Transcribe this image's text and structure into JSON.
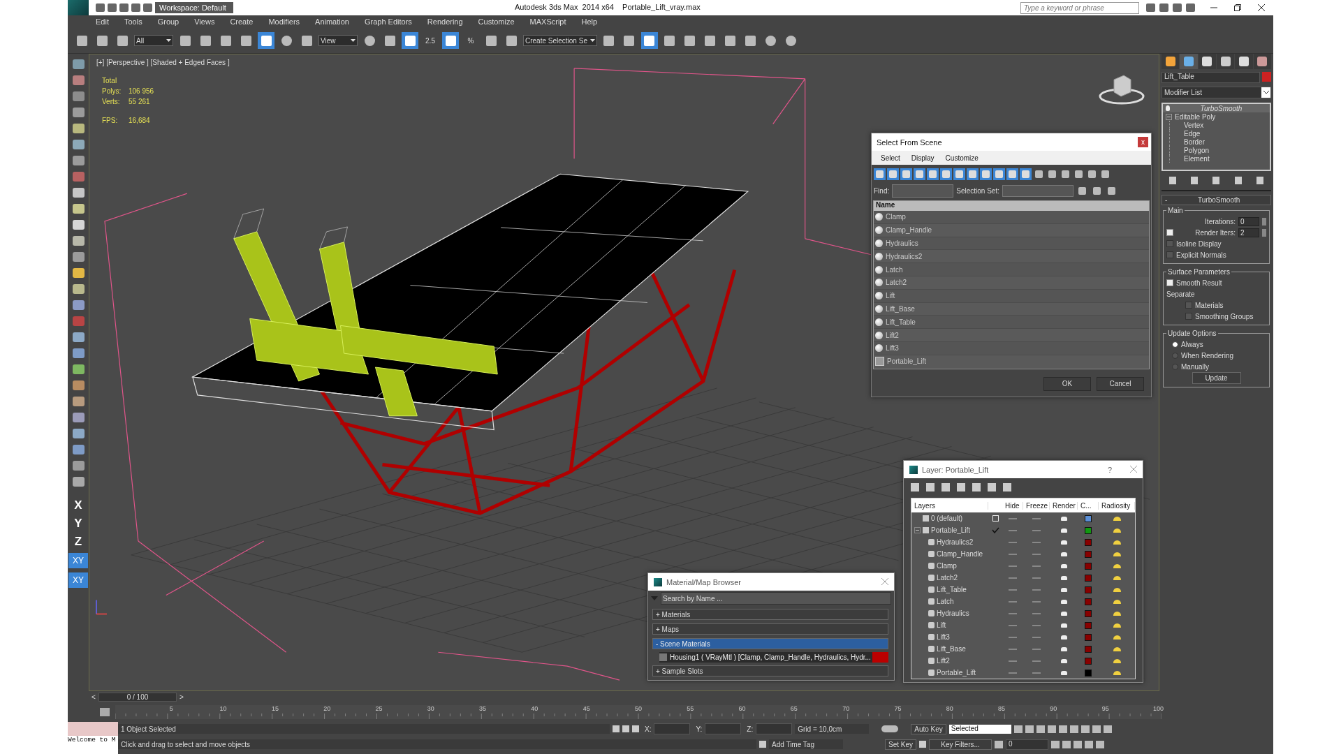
{
  "app_title": {
    "workspace": "Workspace: Default",
    "title": "Autodesk 3ds Max  2014 x64    Portable_Lift_vray.max",
    "search_placeholder": "Type a keyword or phrase"
  },
  "menu": [
    "Edit",
    "Tools",
    "Group",
    "Views",
    "Create",
    "Modifiers",
    "Animation",
    "Graph Editors",
    "Rendering",
    "Customize",
    "MAXScript",
    "Help"
  ],
  "main_toolbar": [
    {
      "kind": "link",
      "selected": false
    },
    {
      "kind": "unlink",
      "selected": false
    },
    {
      "kind": "bind",
      "selected": false
    },
    {
      "kind": "dropdown",
      "value": "All"
    },
    {
      "kind": "select",
      "selected": false
    },
    {
      "kind": "list",
      "selected": false
    },
    {
      "kind": "rect",
      "selected": false
    },
    {
      "kind": "window",
      "selected": false
    },
    {
      "kind": "move",
      "selected": true
    },
    {
      "kind": "rotate",
      "selected": false
    },
    {
      "kind": "scale",
      "selected": false
    },
    {
      "kind": "dropdown",
      "value": "View"
    },
    {
      "kind": "pivot",
      "selected": false
    },
    {
      "kind": "move",
      "selected": false
    },
    {
      "kind": "keyboard",
      "selected": true
    },
    {
      "kind": "snap",
      "label": "2.5",
      "selected": false
    },
    {
      "kind": "angle",
      "selected": true
    },
    {
      "kind": "snap",
      "label": "%",
      "selected": false
    },
    {
      "kind": "spinner",
      "selected": false
    },
    {
      "kind": "edit",
      "selected": false
    },
    {
      "kind": "dropdown",
      "value": "Create Selection Se"
    },
    {
      "kind": "mirror",
      "selected": false
    },
    {
      "kind": "align",
      "selected": false
    },
    {
      "kind": "layers",
      "selected": true
    },
    {
      "kind": "render",
      "selected": false
    },
    {
      "kind": "curve",
      "selected": false
    },
    {
      "kind": "schematic",
      "selected": false
    },
    {
      "kind": "material",
      "selected": false
    },
    {
      "kind": "render",
      "selected": false
    },
    {
      "kind": "teapot",
      "selected": false
    },
    {
      "kind": "teapot",
      "selected": false
    }
  ],
  "viewport": {
    "label": "[+] [Perspective ] [Shaded + Edged Faces ]",
    "stats": [
      {
        "name": "Total"
      },
      {
        "name": "Polys:",
        "value": "106 956"
      },
      {
        "name": "Verts:",
        "value": "55 261"
      }
    ],
    "fps": {
      "name": "FPS:",
      "value": "16,684"
    }
  },
  "axis_buttons": [
    {
      "label": "X",
      "kind": "plain"
    },
    {
      "label": "Y",
      "kind": "plain"
    },
    {
      "label": "Z",
      "kind": "plain"
    },
    {
      "label": "XY",
      "kind": "button"
    },
    {
      "label": "XY",
      "kind": "button"
    }
  ],
  "command_panel": {
    "tabs": [
      {
        "kind": "create",
        "selected": false
      },
      {
        "kind": "modify",
        "selected": true
      },
      {
        "kind": "hierarchy",
        "selected": false
      },
      {
        "kind": "motion",
        "selected": false
      },
      {
        "kind": "display",
        "selected": false
      },
      {
        "kind": "utilities",
        "selected": false
      }
    ],
    "object_name": "Lift_Table",
    "modifier_list": "Modifier List",
    "stack": [
      {
        "name": "TurboSmooth",
        "kind": "modifier"
      },
      {
        "name": "Editable Poly",
        "kind": "base",
        "expanded": true,
        "children": [
          {
            "name": "Vertex"
          },
          {
            "name": "Edge"
          },
          {
            "name": "Border"
          },
          {
            "name": "Polygon"
          },
          {
            "name": "Element"
          }
        ]
      }
    ],
    "rollout": {
      "title": "TurboSmooth",
      "sign": "-",
      "groups": [
        {
          "title": "Main",
          "controls": [
            {
              "kind": "spinner",
              "label": "Iterations:",
              "value": "0"
            },
            {
              "kind": "checkspinner",
              "label": "Render Iters:",
              "value": "2",
              "checked": true
            },
            {
              "kind": "checkbox",
              "label": "Isoline Display",
              "checked": false
            },
            {
              "kind": "checkbox",
              "label": "Explicit Normals",
              "checked": false
            }
          ]
        },
        {
          "title": "Surface Parameters",
          "controls": [
            {
              "kind": "checkbox",
              "label": "Smooth Result",
              "checked": true
            },
            {
              "kind": "text",
              "label": "Separate"
            },
            {
              "kind": "subcheckbox",
              "label": "Materials",
              "checked": false
            },
            {
              "kind": "subcheckbox",
              "label": "Smoothing Groups",
              "checked": false
            }
          ]
        },
        {
          "title": "Update Options",
          "controls": [
            {
              "kind": "radio",
              "label": "Always",
              "selected": true
            },
            {
              "kind": "radio",
              "label": "When Rendering",
              "selected": false
            },
            {
              "kind": "radio",
              "label": "Manually",
              "selected": false
            },
            {
              "kind": "button",
              "label": "Update"
            }
          ]
        }
      ]
    }
  },
  "select_from_scene": {
    "title": "Select From Scene",
    "close": "x",
    "menu": [
      "Select",
      "Display",
      "Customize"
    ],
    "filters": [
      {
        "on": true
      },
      {
        "on": true
      },
      {
        "on": true
      },
      {
        "on": true
      },
      {
        "on": true
      },
      {
        "on": true
      },
      {
        "on": true
      },
      {
        "on": true
      },
      {
        "on": true
      },
      {
        "on": true
      },
      {
        "on": true
      },
      {
        "on": true
      }
    ],
    "find_label": "Find:",
    "selection_set_label": "Selection Set:",
    "column": "Name",
    "rows": [
      {
        "name": "Clamp",
        "kind": "object",
        "selected": false
      },
      {
        "name": "Clamp_Handle",
        "kind": "object",
        "selected": false
      },
      {
        "name": "Hydraulics",
        "kind": "object",
        "selected": false
      },
      {
        "name": "Hydraulics2",
        "kind": "object",
        "selected": false
      },
      {
        "name": "Latch",
        "kind": "object",
        "selected": false
      },
      {
        "name": "Latch2",
        "kind": "object",
        "selected": false
      },
      {
        "name": "Lift",
        "kind": "object",
        "selected": false
      },
      {
        "name": "Lift_Base",
        "kind": "object",
        "selected": false
      },
      {
        "name": "Lift_Table",
        "kind": "object",
        "selected": false
      },
      {
        "name": "Lift2",
        "kind": "object",
        "selected": false
      },
      {
        "name": "Lift3",
        "kind": "object",
        "selected": false
      },
      {
        "name": "Portable_Lift",
        "kind": "group",
        "selected": false
      }
    ],
    "buttons": [
      "OK",
      "Cancel"
    ]
  },
  "layer_dialog": {
    "title": "Layer: Portable_Lift",
    "help": "?",
    "columns": [
      "Layers",
      "Hide",
      "Freeze",
      "Render",
      "C...",
      "Radiosity"
    ],
    "layers": [
      {
        "name": "0 (default)",
        "current": false,
        "color": "#5b8fd6"
      },
      {
        "name": "Portable_Lift",
        "current": true,
        "expanded": true,
        "color": "#119911",
        "children": [
          {
            "name": "Hydraulics2",
            "color": "#880000"
          },
          {
            "name": "Clamp_Handle",
            "color": "#880000"
          },
          {
            "name": "Clamp",
            "color": "#880000"
          },
          {
            "name": "Latch2",
            "color": "#880000"
          },
          {
            "name": "Lift_Table",
            "color": "#880000"
          },
          {
            "name": "Latch",
            "color": "#880000"
          },
          {
            "name": "Hydraulics",
            "color": "#880000"
          },
          {
            "name": "Lift",
            "color": "#880000"
          },
          {
            "name": "Lift3",
            "color": "#880000"
          },
          {
            "name": "Lift_Base",
            "color": "#880000"
          },
          {
            "name": "Lift2",
            "color": "#880000"
          },
          {
            "name": "Portable_Lift",
            "color": "#000000"
          }
        ]
      }
    ]
  },
  "material_browser": {
    "title": "Material/Map Browser",
    "search_placeholder": "Search by Name ...",
    "groups": [
      {
        "label": "+ Materials",
        "selected": false
      },
      {
        "label": "+ Maps",
        "selected": false
      },
      {
        "label": "- Scene Materials",
        "selected": true,
        "items": [
          "Housing1 ( VRayMtl ) [Clamp, Clamp_Handle, Hydraulics, Hydr..."
        ]
      },
      {
        "label": "+ Sample Slots",
        "selected": false
      }
    ]
  },
  "timeline": {
    "prev": "<",
    "frame": "0 / 100",
    "next": ">",
    "ticks": [
      "5",
      "10",
      "15",
      "20",
      "25",
      "30",
      "35",
      "40",
      "45",
      "50",
      "55",
      "60",
      "65",
      "70",
      "75",
      "80",
      "85",
      "90",
      "95",
      "100"
    ]
  },
  "status_bar": {
    "listener": "Welcome to M",
    "selection": "1 Object Selected",
    "prompt": "Click and drag to select and move objects",
    "coords": [
      "X:",
      "Y:",
      "Z:"
    ],
    "grid": "Grid = 10,0cm",
    "add_time_tag": "Add Time Tag",
    "auto_key": "Auto Key",
    "set_key": "Set Key",
    "key_mode": "Selected",
    "key_filters": "Key Filters...",
    "frame": "0"
  }
}
